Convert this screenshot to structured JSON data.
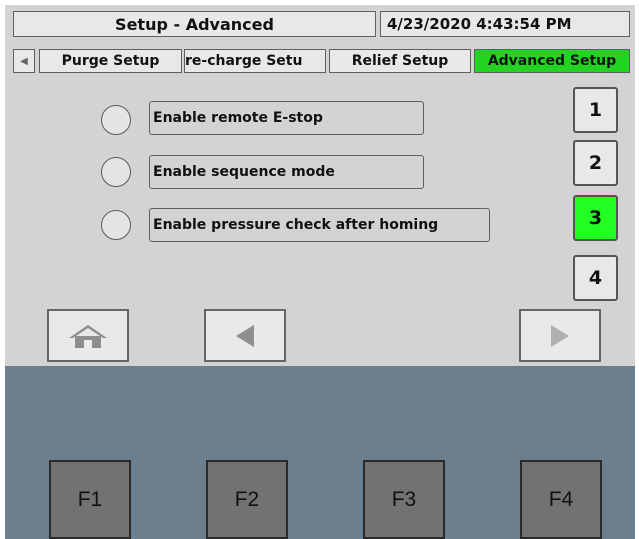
{
  "header": {
    "title": "Setup - Advanced",
    "datetime": "4/23/2020 4:43:54 PM"
  },
  "tabs": [
    {
      "label": "Purge Setup"
    },
    {
      "label": "re-charge Setu"
    },
    {
      "label": "Relief Setup"
    },
    {
      "label": "Advanced Setup",
      "active": true
    }
  ],
  "options": [
    {
      "label": "Enable remote E-stop",
      "selected": false
    },
    {
      "label": "Enable sequence mode",
      "selected": false
    },
    {
      "label": "Enable pressure check after homing",
      "selected": false
    }
  ],
  "page_buttons": [
    {
      "label": "1"
    },
    {
      "label": "2"
    },
    {
      "label": "3",
      "active": true
    },
    {
      "label": "4"
    }
  ],
  "function_keys": [
    {
      "label": "F1"
    },
    {
      "label": "F2"
    },
    {
      "label": "F3"
    },
    {
      "label": "F4"
    }
  ],
  "nav_icons": [
    "home-icon",
    "arrow-left-icon",
    "arrow-right-icon"
  ],
  "colors": {
    "active_tab": "#22d322",
    "active_page": "#22ff22",
    "screen_bg": "#d3d3d3",
    "bezel": "#6b7f8e"
  }
}
